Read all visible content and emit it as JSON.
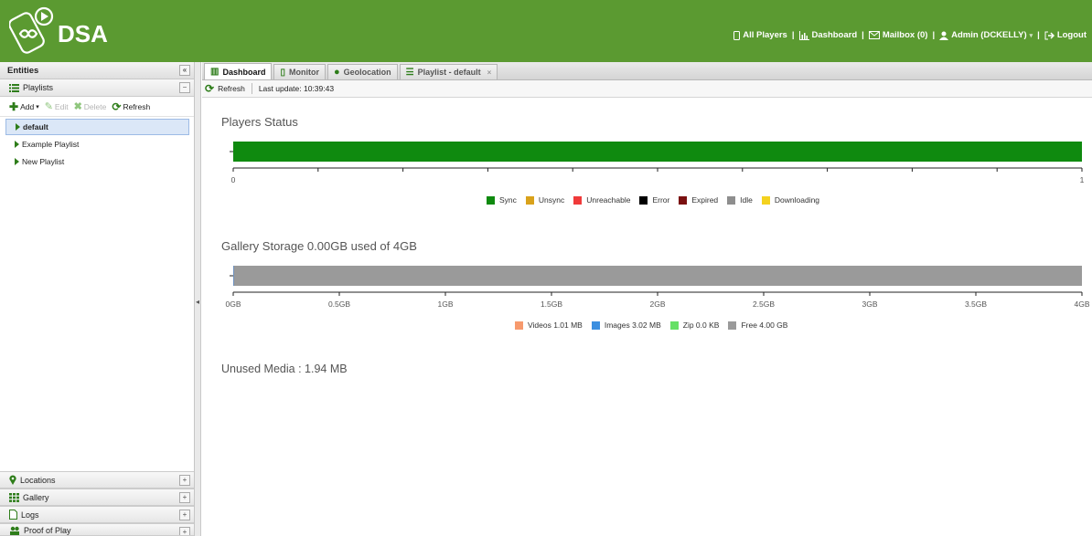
{
  "app": {
    "name": "DSA"
  },
  "topnav": {
    "all_players": "All Players",
    "dashboard": "Dashboard",
    "mailbox": "Mailbox (0)",
    "admin": "Admin (DCKELLY)",
    "logout": "Logout",
    "sep": "|"
  },
  "sidebar": {
    "title": "Entities",
    "collapse": "«",
    "playlists": {
      "label": "Playlists",
      "toggle": "−"
    },
    "toolbar": {
      "add": "Add",
      "edit": "Edit",
      "delete": "Delete",
      "refresh": "Refresh"
    },
    "items": [
      {
        "label": "default",
        "selected": true
      },
      {
        "label": "Example Playlist"
      },
      {
        "label": "New Playlist"
      }
    ],
    "bottom": [
      {
        "label": "Locations",
        "toggle": "+"
      },
      {
        "label": "Gallery",
        "toggle": "+"
      },
      {
        "label": "Logs",
        "toggle": "+"
      },
      {
        "label": "Proof of Play",
        "toggle": "+"
      }
    ]
  },
  "tabs": [
    {
      "label": "Dashboard",
      "active": true
    },
    {
      "label": "Monitor"
    },
    {
      "label": "Geolocation"
    },
    {
      "label": "Playlist - default",
      "closable": true,
      "close": "×"
    }
  ],
  "subbar": {
    "refresh": "Refresh",
    "last_update": "Last update: 10:39:43"
  },
  "players_status": {
    "title": "Players Status",
    "tick_labels": [
      "0",
      "1"
    ],
    "legend": [
      {
        "label": "Sync",
        "color": "#0f8a0f"
      },
      {
        "label": "Unsync",
        "color": "#d9a21b"
      },
      {
        "label": "Unreachable",
        "color": "#f03a3a"
      },
      {
        "label": "Error",
        "color": "#000000"
      },
      {
        "label": "Expired",
        "color": "#7a1010"
      },
      {
        "label": "Idle",
        "color": "#8e8e8e"
      },
      {
        "label": "Downloading",
        "color": "#f4d21f"
      }
    ]
  },
  "gallery_storage": {
    "title": "Gallery Storage 0.00GB used of 4GB",
    "tick_labels": [
      "0GB",
      "0.5GB",
      "1GB",
      "1.5GB",
      "2GB",
      "2.5GB",
      "3GB",
      "3.5GB",
      "4GB"
    ],
    "legend": [
      {
        "label": "Videos 1.01 MB",
        "color": "#f79a6d"
      },
      {
        "label": "Images 3.02 MB",
        "color": "#3c8fe0"
      },
      {
        "label": "Zip 0.0 KB",
        "color": "#66e066"
      },
      {
        "label": "Free 4.00 GB",
        "color": "#9a9a9a"
      }
    ]
  },
  "unused_media": "Unused Media : 1.94 MB",
  "chart_data": [
    {
      "type": "bar",
      "title": "Players Status",
      "orientation": "horizontal",
      "stacked": true,
      "categories": [
        ""
      ],
      "xlim": [
        0,
        1
      ],
      "series": [
        {
          "name": "Sync",
          "values": [
            1
          ],
          "color": "#0f8a0f"
        },
        {
          "name": "Unsync",
          "values": [
            0
          ],
          "color": "#d9a21b"
        },
        {
          "name": "Unreachable",
          "values": [
            0
          ],
          "color": "#f03a3a"
        },
        {
          "name": "Error",
          "values": [
            0
          ],
          "color": "#000000"
        },
        {
          "name": "Expired",
          "values": [
            0
          ],
          "color": "#7a1010"
        },
        {
          "name": "Idle",
          "values": [
            0
          ],
          "color": "#8e8e8e"
        },
        {
          "name": "Downloading",
          "values": [
            0
          ],
          "color": "#f4d21f"
        }
      ],
      "legend": "bottom"
    },
    {
      "type": "bar",
      "title": "Gallery Storage 0.00GB used of 4GB",
      "orientation": "horizontal",
      "stacked": true,
      "categories": [
        ""
      ],
      "xlim": [
        0,
        4
      ],
      "series": [
        {
          "name": "Videos 1.01 MB",
          "values": [
            0.00101
          ],
          "color": "#f79a6d"
        },
        {
          "name": "Images 3.02 MB",
          "values": [
            0.00302
          ],
          "color": "#3c8fe0"
        },
        {
          "name": "Zip 0.0 KB",
          "values": [
            0
          ],
          "color": "#66e066"
        },
        {
          "name": "Free 4.00 GB",
          "values": [
            3.996
          ],
          "color": "#9a9a9a"
        }
      ],
      "legend": "bottom"
    }
  ]
}
